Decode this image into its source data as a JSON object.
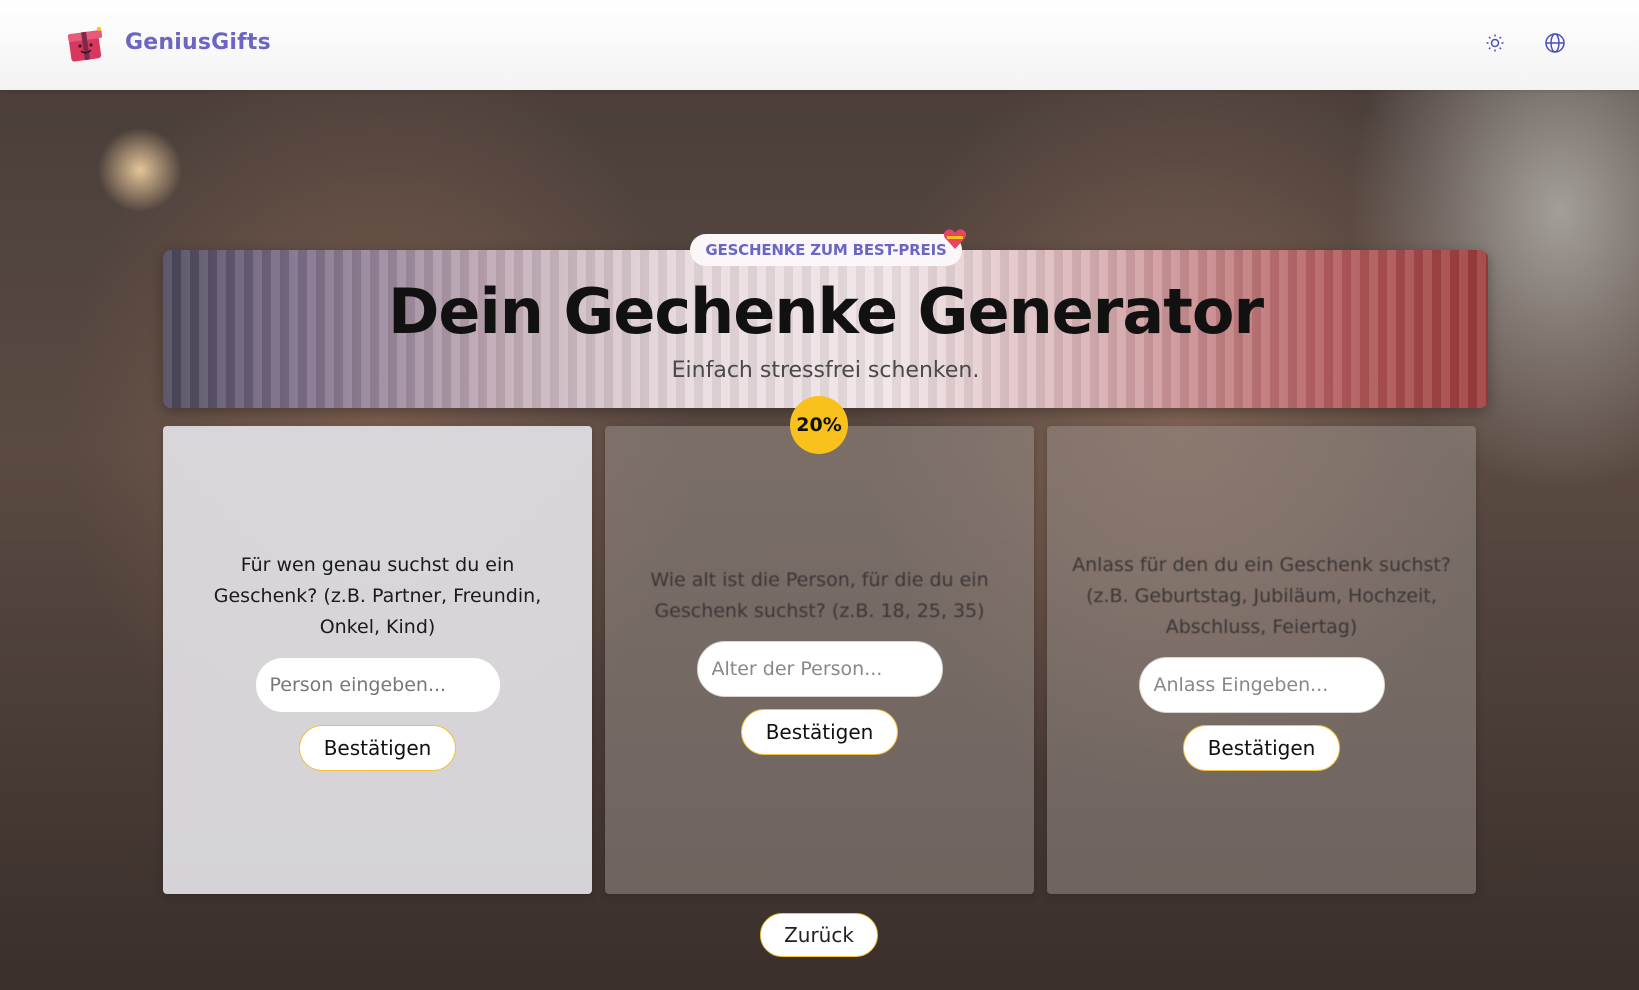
{
  "navbar": {
    "brand": "GeniusGifts",
    "logo_icon": "gift-box-icon",
    "theme_icon": "sun-icon",
    "language_icon": "globe-icon"
  },
  "hero": {
    "badge": "GESCHENKE ZUM BEST-PREIS",
    "badge_icon": "heart-gift-icon",
    "title": "Dein Gechenke Generator",
    "subtitle": "Einfach stressfrei schenken.",
    "progress_label": "20%",
    "progress_value": 0.2
  },
  "cards": [
    {
      "question": "Für wen genau suchst du ein Geschenk? (z.B. Partner, Freundin, Onkel, Kind)",
      "placeholder": "Person eingeben...",
      "button": "Bestätigen"
    },
    {
      "question": "Wie alt ist die Person, für die du ein Geschenk suchst? (z.B. 18, 25, 35)",
      "placeholder": "Alter der Person...",
      "button": "Bestätigen"
    },
    {
      "question": "Anlass für den du ein Geschenk suchst? (z.B. Geburtstag, Jubiläum, Hochzeit, Abschluss, Feiertag)",
      "placeholder": "Anlass Eingeben...",
      "button": "Bestätigen"
    }
  ],
  "back_button": "Zurück",
  "colors": {
    "brand": "#6b66c4",
    "accent": "#f8c11c",
    "button_border": "#f2c23a"
  }
}
